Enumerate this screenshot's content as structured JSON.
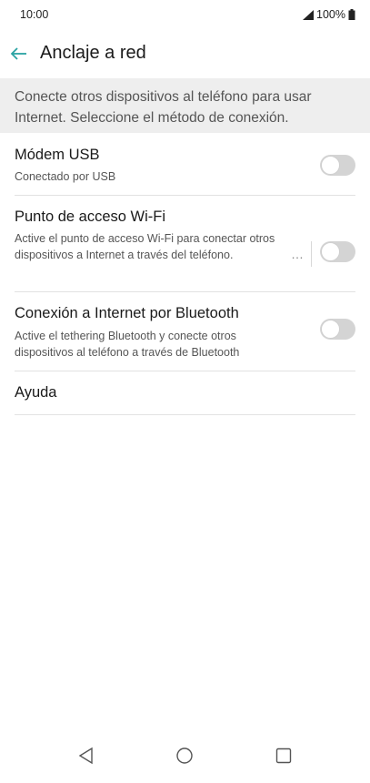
{
  "status_bar": {
    "time": "10:00",
    "battery": "100%"
  },
  "header": {
    "title": "Anclaje a red"
  },
  "description": "Conecte otros dispositivos al teléfono para usar Internet. Seleccione el método de conexión.",
  "settings": {
    "usb": {
      "title": "Módem USB",
      "subtitle": "Conectado por USB",
      "enabled": false
    },
    "wifi": {
      "title": "Punto de acceso Wi-Fi",
      "subtitle": "Active el punto de acceso Wi-Fi para conectar otros dispositivos a Internet a través del teléfono.",
      "more": "…",
      "enabled": false
    },
    "bluetooth": {
      "title": "Conexión a Internet por Bluetooth",
      "subtitle": "Active el tethering Bluetooth y conecte otros dispositivos al teléfono a través de Bluetooth",
      "enabled": false
    },
    "help": {
      "title": "Ayuda"
    }
  },
  "colors": {
    "accent": "#2aa3a3",
    "toggle_off": "#d4d4d4",
    "banner": "#eeeeee"
  },
  "icons": {
    "back": "arrow-left-icon",
    "signal": "signal-icon",
    "battery": "battery-icon",
    "nav_back": "triangle-back-icon",
    "nav_home": "circle-home-icon",
    "nav_recent": "square-recent-icon"
  }
}
